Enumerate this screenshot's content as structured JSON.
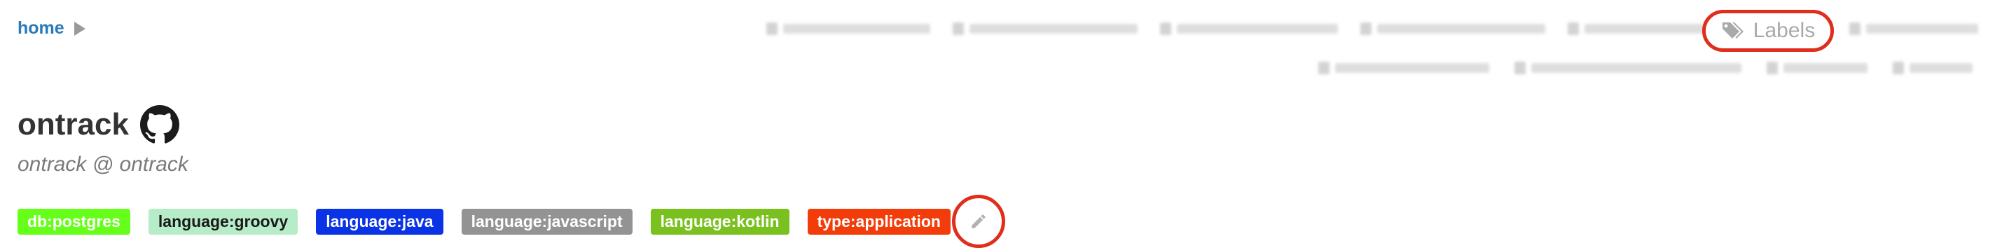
{
  "breadcrumb": {
    "home": "home"
  },
  "commands": {
    "labels": "Labels"
  },
  "project": {
    "name": "ontrack",
    "description": "ontrack @ ontrack",
    "labels": [
      {
        "text": "db:postgres",
        "bg": "#66ff1a",
        "fg": "#ffffff"
      },
      {
        "text": "language:groovy",
        "bg": "#b6ecc7",
        "fg": "#1a1a1a"
      },
      {
        "text": "language:java",
        "bg": "#0a33e6",
        "fg": "#ffffff"
      },
      {
        "text": "language:javascript",
        "bg": "#939393",
        "fg": "#ffffff"
      },
      {
        "text": "language:kotlin",
        "bg": "#7ac11f",
        "fg": "#ffffff"
      },
      {
        "text": "type:application",
        "bg": "#f23c0a",
        "fg": "#ffffff"
      }
    ]
  },
  "colors": {
    "link": "#2a7ab8",
    "highlight": "#e02d1c",
    "muted": "#a9a9a9"
  }
}
